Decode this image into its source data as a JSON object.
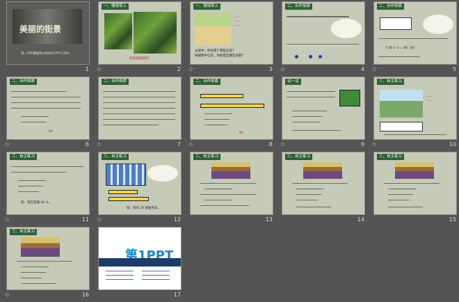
{
  "slides": [
    {
      "num": "1",
      "title": "美丽的街景",
      "subtitle": "第一PPT模板网-WWW.1PPT.COM"
    },
    {
      "num": "2",
      "heading": "一、情境导入",
      "caption": "你知道是啥吗？"
    },
    {
      "num": "3",
      "heading": "一、情境导入",
      "q1": "从图中，你知道了哪些信息？",
      "q2": "根据图中信息，你能提出哪些问题？"
    },
    {
      "num": "4",
      "heading": "二、合作探索"
    },
    {
      "num": "5",
      "heading": "二、合作探索",
      "eq": "7:30 + 5 = 80（分）"
    },
    {
      "num": "6",
      "heading": "二、合作探索",
      "hl": "80"
    },
    {
      "num": "7",
      "heading": "二、合作探索"
    },
    {
      "num": "8",
      "heading": "二、合作探索",
      "hl": "80"
    },
    {
      "num": "9",
      "heading": "试一试"
    },
    {
      "num": "10",
      "heading": "三、自主练习"
    },
    {
      "num": "11",
      "heading": "三、自主练习",
      "answer": "答：现在还剩 42 人。"
    },
    {
      "num": "12",
      "heading": "三、自主练习",
      "answer": "答：现有 20 套服务员。"
    },
    {
      "num": "13",
      "heading": "三、自主练习"
    },
    {
      "num": "14",
      "heading": "三、自主练习"
    },
    {
      "num": "15",
      "heading": "三、自主练习"
    },
    {
      "num": "16",
      "heading": "三、自主练习"
    },
    {
      "num": "17",
      "brand": "第1PPT"
    }
  ]
}
